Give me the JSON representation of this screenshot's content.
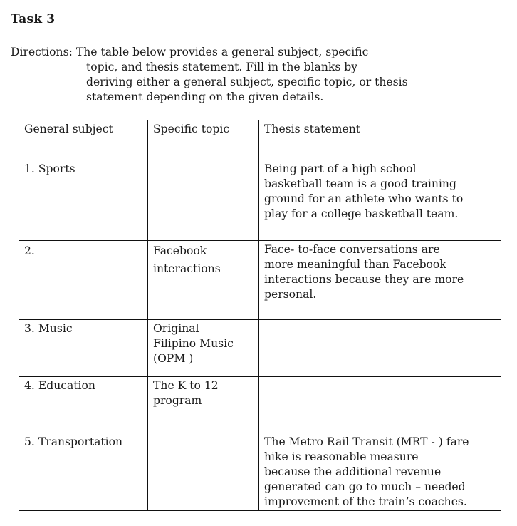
{
  "task": {
    "title": "Task 3"
  },
  "directions": {
    "label": "Directions:",
    "lines": [
      "The table below provides a general subject, specific",
      "topic, and thesis statement. Fill in the blanks by",
      "deriving either a general subject, specific topic, or thesis",
      "statement depending on the given details."
    ]
  },
  "table": {
    "headers": [
      "General subject",
      "Specific topic",
      "Thesis statement"
    ],
    "rows": [
      {
        "general_subject": "1.  Sports",
        "specific_topic": "",
        "thesis_statement": [
          "Being part of a high school",
          "basketball team is a good training",
          "ground for an athlete who wants to",
          "play for a college basketball team."
        ]
      },
      {
        "general_subject": "2.",
        "specific_topic": [
          "Facebook",
          "interactions"
        ],
        "thesis_statement": [
          "Face- to-face conversations are",
          "more meaningful than Facebook",
          "interactions because they are more",
          "personal."
        ]
      },
      {
        "general_subject": "3.  Music",
        "specific_topic": [
          "Original",
          "Filipino Music",
          "(OPM )"
        ],
        "thesis_statement": []
      },
      {
        "general_subject": "4.  Education",
        "specific_topic": [
          "The K to 12",
          "program"
        ],
        "thesis_statement": []
      },
      {
        "general_subject": "5.  Transportation",
        "specific_topic": "",
        "thesis_statement": [
          "The Metro Rail Transit (MRT - ) fare",
          "hike is reasonable measure",
          "because the additional  revenue",
          "generated can go to much – needed",
          "improvement of the train’s coaches."
        ]
      }
    ]
  }
}
